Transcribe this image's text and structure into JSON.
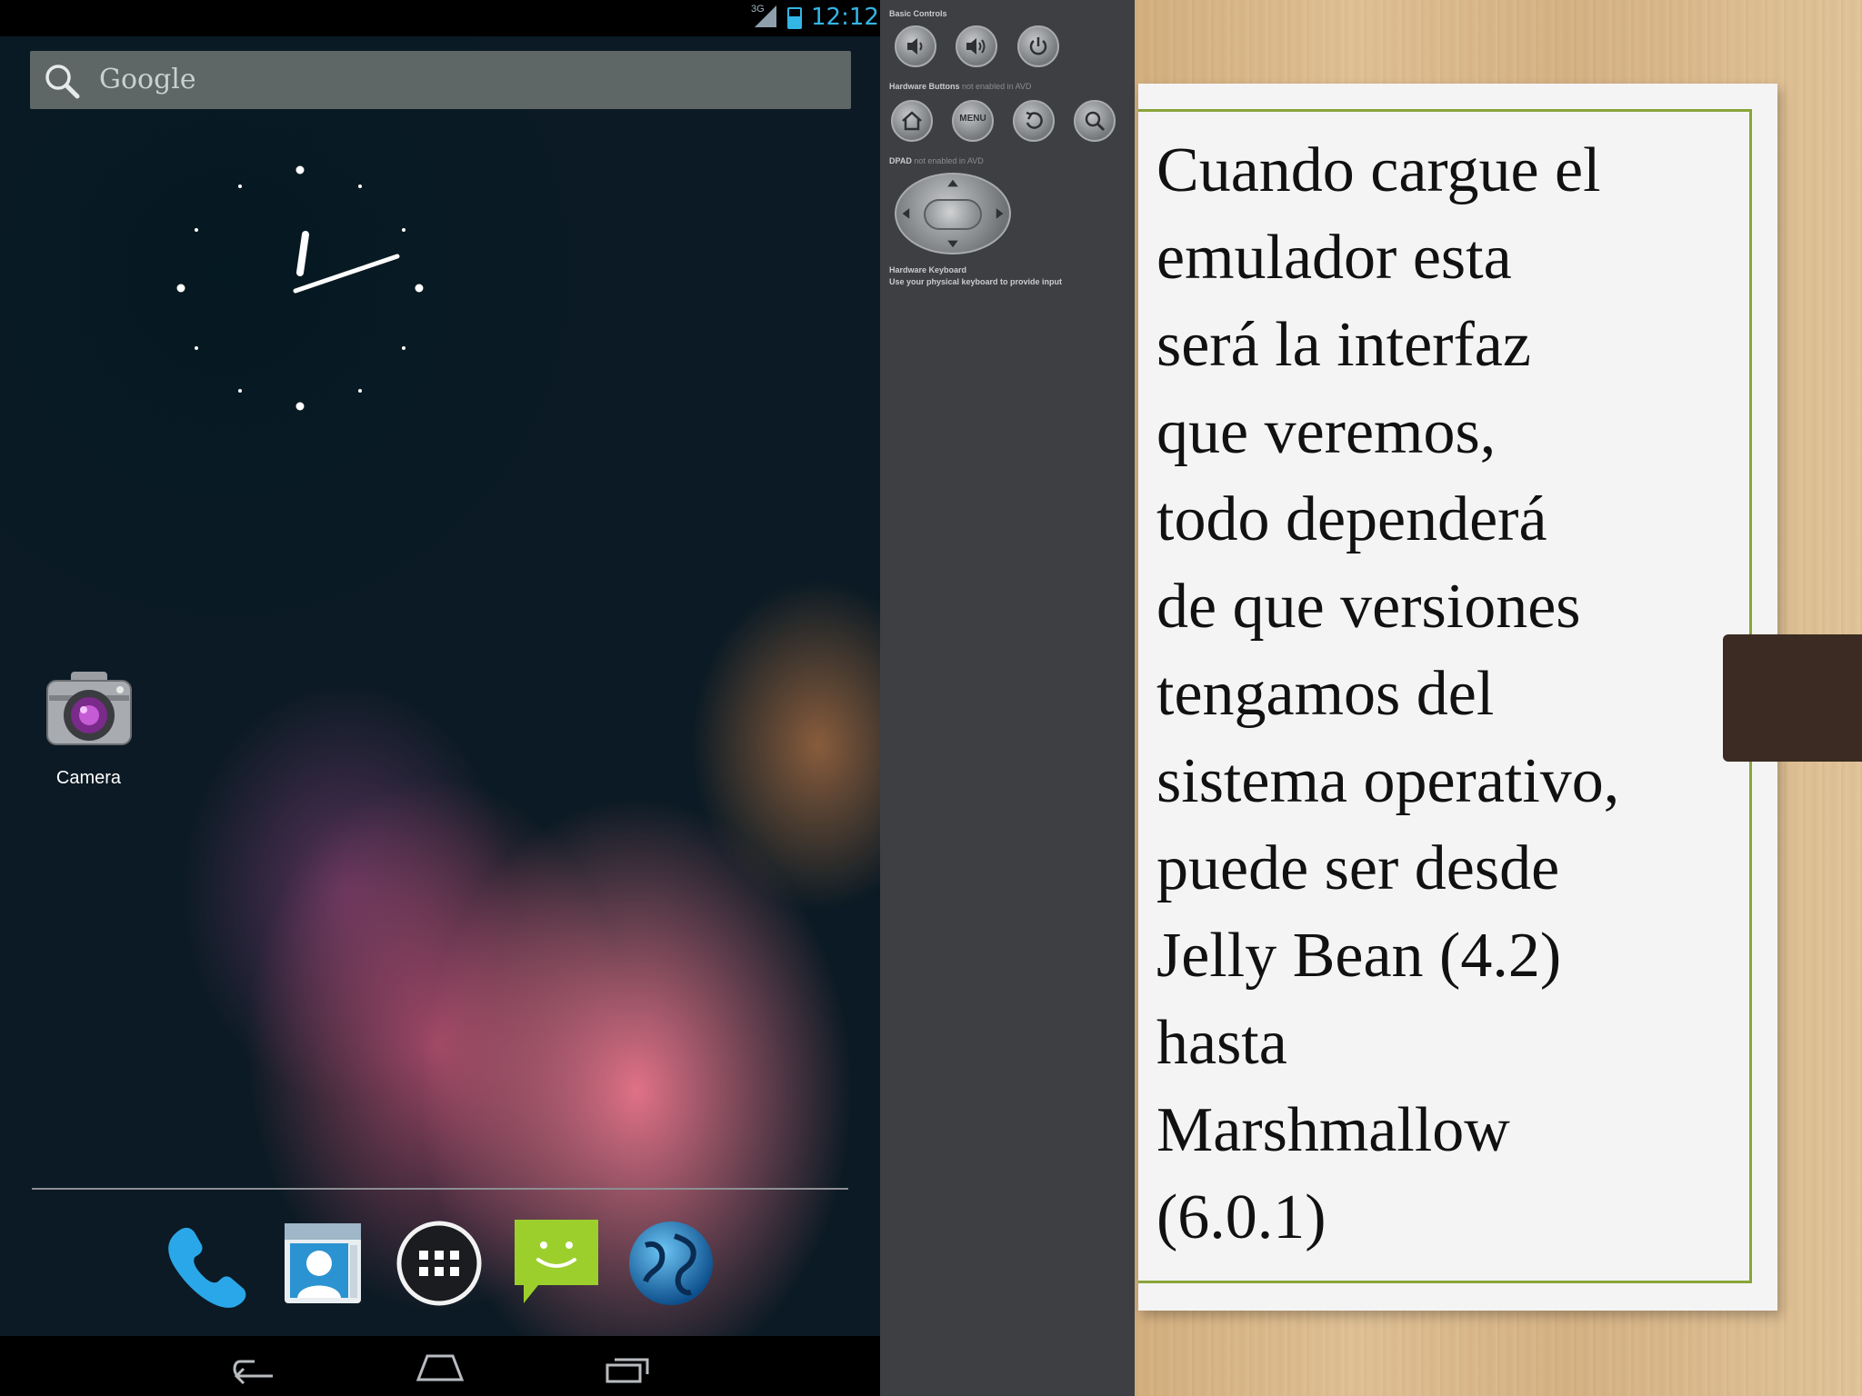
{
  "status_bar": {
    "network": "3G",
    "time": "12:12"
  },
  "search": {
    "placeholder": "Google"
  },
  "home": {
    "camera_label": "Camera"
  },
  "dock": {
    "items": [
      "phone-icon",
      "contacts-icon",
      "app-drawer-icon",
      "messaging-icon",
      "browser-icon"
    ]
  },
  "navigation": {
    "items": [
      "back-icon",
      "home-icon",
      "recent-apps-icon"
    ]
  },
  "emulator_controls": {
    "basic_controls_label": "Basic Controls",
    "hardware_buttons_label": "Hardware Buttons",
    "hardware_buttons_note": "not enabled in AVD",
    "menu_label": "MENU",
    "dpad_label": "DPAD",
    "dpad_note": "not enabled in AVD",
    "keyboard_label": "Hardware Keyboard",
    "keyboard_note": "Use your physical keyboard to provide input"
  },
  "slide": {
    "lines": [
      "Cuando cargue el",
      "emulador esta",
      "será la interfaz",
      "que veremos,",
      "todo dependerá",
      "de que versiones",
      "tengamos del",
      "sistema operativo,",
      "puede ser desde",
      "Jelly Bean (4.2)",
      "hasta",
      "Marshmallow",
      "(6.0.1)"
    ]
  },
  "colors": {
    "status_accent": "#33b5e5",
    "frame_green": "#8aa43a",
    "controls_bg": "#3d3f42"
  }
}
